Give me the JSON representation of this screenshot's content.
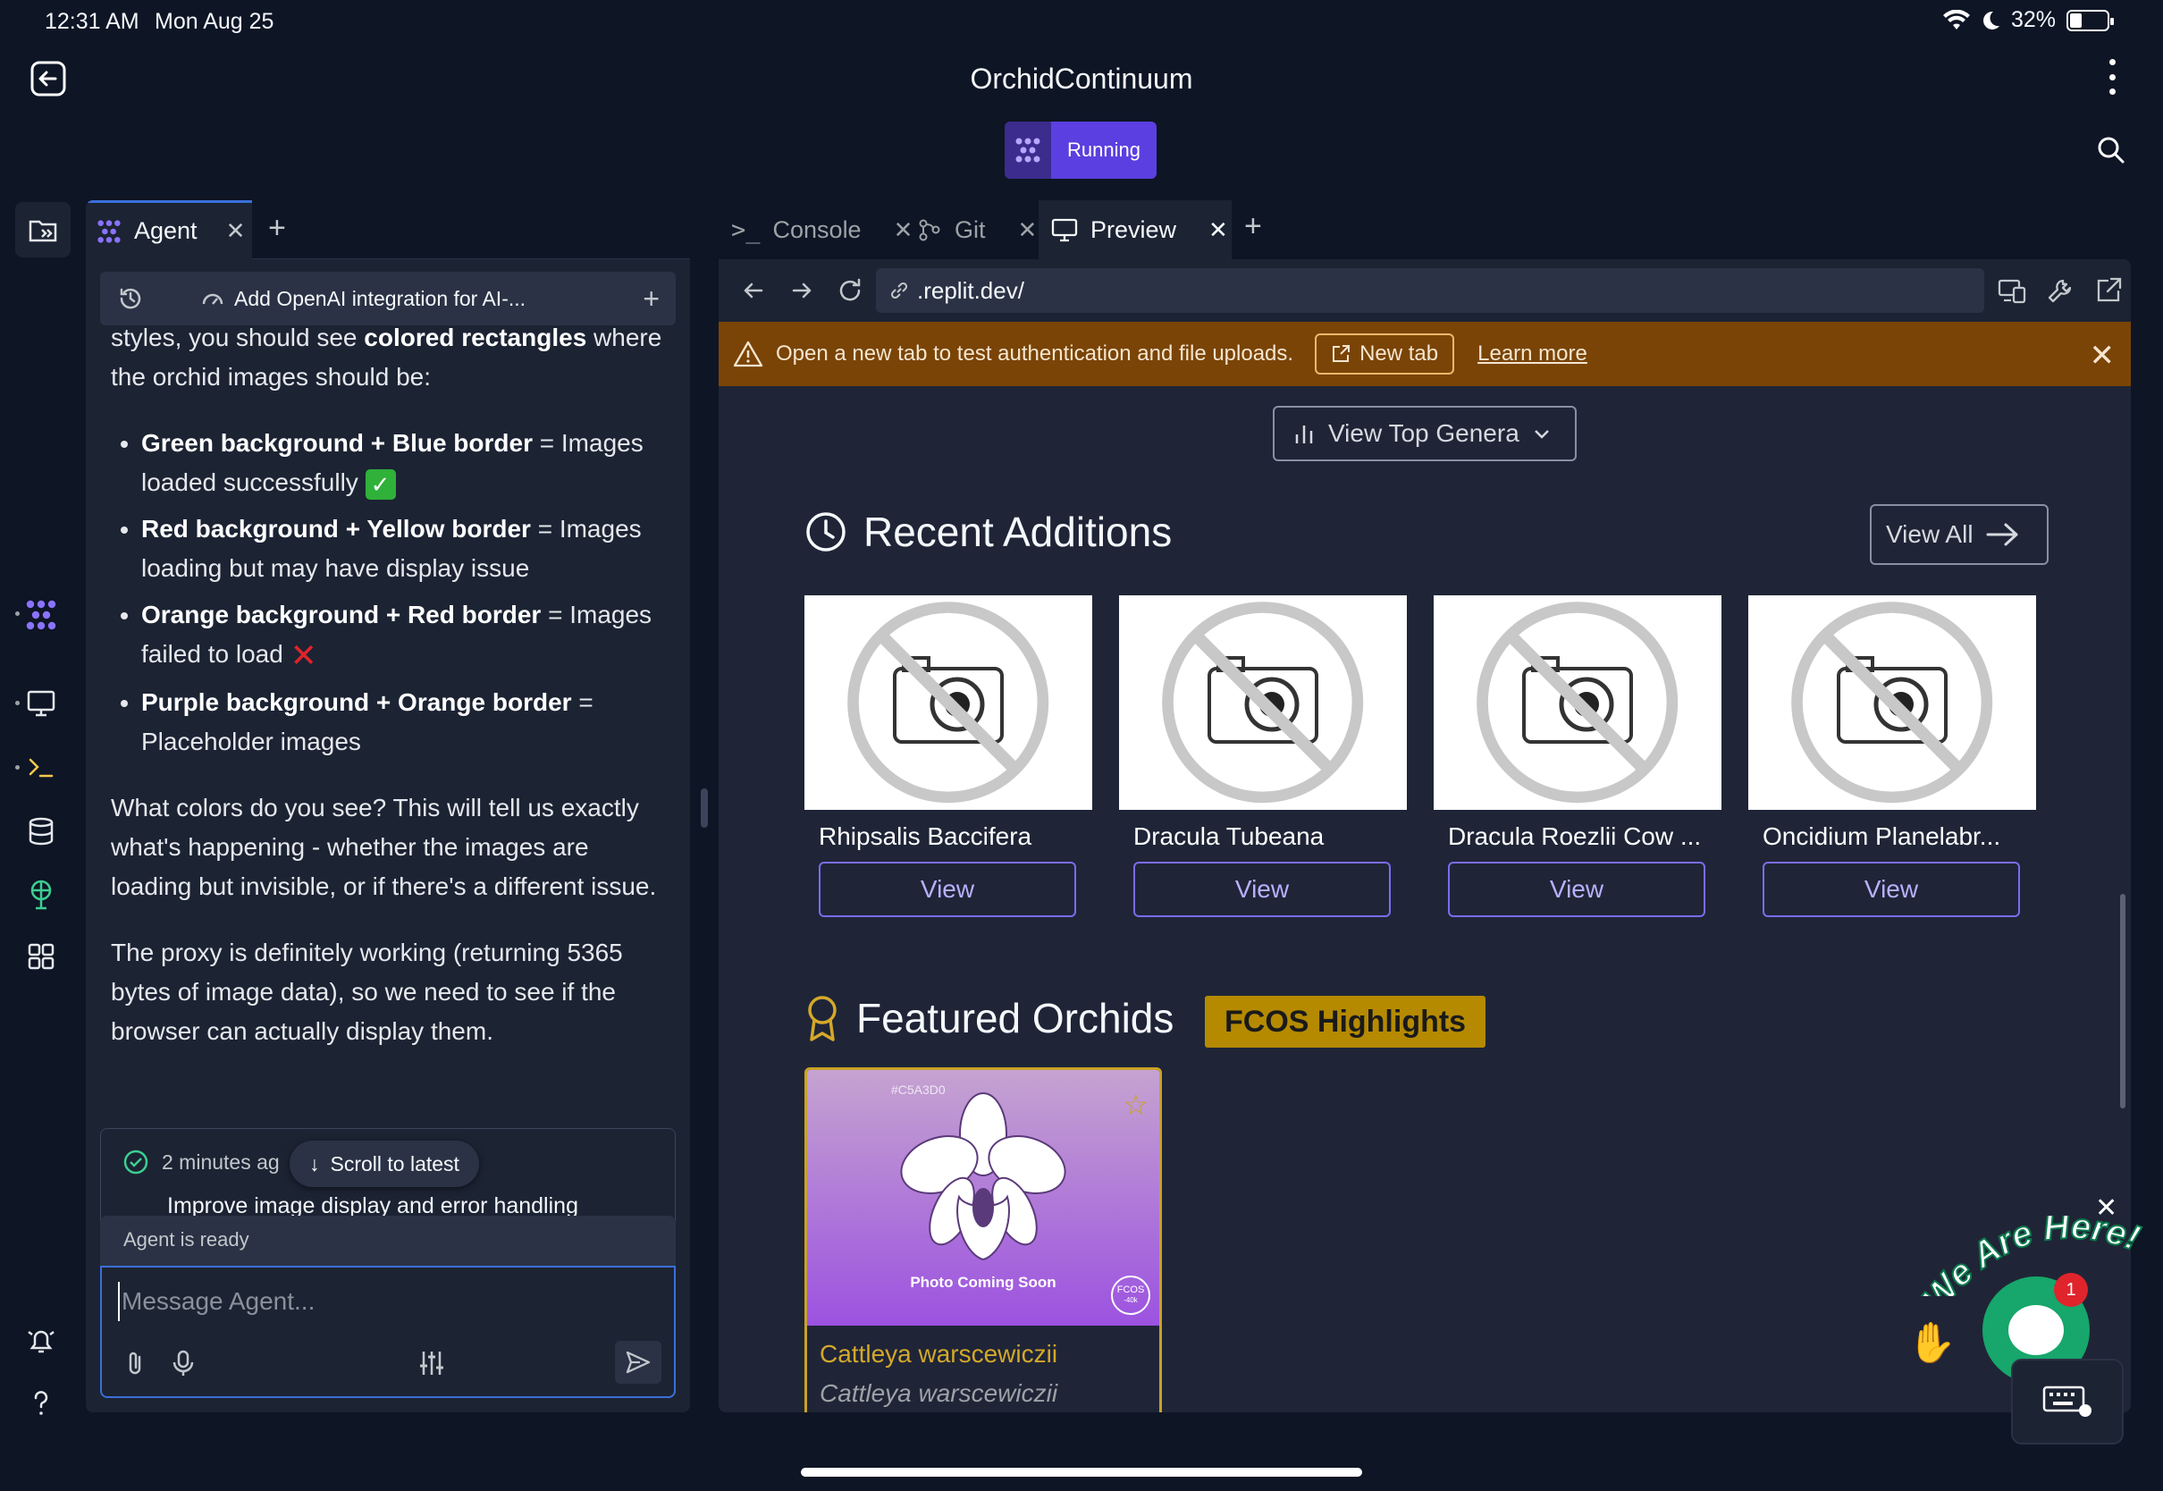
{
  "status_bar": {
    "time": "12:31 AM",
    "date": "Mon Aug 25",
    "battery": "32%"
  },
  "header": {
    "title": "OrchidContinuum",
    "run_status": "Running"
  },
  "agent": {
    "tab_label": "Agent",
    "task_title": "Add OpenAI integration for AI-...",
    "messages": {
      "intro_pre": "styles, you should see ",
      "intro_bold": "colored rectangles",
      "intro_post": " where the orchid images should be:",
      "bullets": [
        {
          "bold": "Green background + Blue border",
          "text": " = Images loaded successfully "
        },
        {
          "bold": "Red background + Yellow border",
          "text": " = Images loading but may have display issue"
        },
        {
          "bold": "Orange background + Red border",
          "text": " = Images failed to load "
        },
        {
          "bold": "Purple background + Orange border",
          "text": " = Placeholder images"
        }
      ],
      "check_emoji": "✓",
      "cross_emoji": "✕",
      "para1": "What colors do you see? This will tell us exactly what's happening - whether the images are loading but invisible, or if there's a different issue.",
      "para2": "The proxy is definitely working (returning 5365 bytes of image data), so we need to see if the browser can actually display them."
    },
    "checkpoint": {
      "time": "2 minutes ag",
      "description": "Improve image display and error handling"
    },
    "scroll_latest": "Scroll to latest",
    "status": "Agent is ready",
    "composer_placeholder": "Message Agent..."
  },
  "workspace": {
    "tabs": [
      {
        "label": "Console"
      },
      {
        "label": "Git"
      },
      {
        "label": "Preview"
      }
    ],
    "url": ".replit.dev/",
    "notice": {
      "message": "Open a new tab to test authentication and file uploads.",
      "new_tab": "New tab",
      "learn_more": "Learn more"
    }
  },
  "preview": {
    "genera_button": "View Top Genera",
    "recent_title": "Recent Additions",
    "view_all": "View All",
    "recent_items": [
      {
        "name": "Rhipsalis Baccifera",
        "action": "View"
      },
      {
        "name": "Dracula Tubeana",
        "action": "View"
      },
      {
        "name": "Dracula Roezlii Cow ...",
        "action": "View"
      },
      {
        "name": "Oncidium Planelabr...",
        "action": "View"
      }
    ],
    "featured_title": "Featured Orchids",
    "featured_badge": "FCOS Highlights",
    "featured": {
      "hex": "#C5A3D0",
      "photo_text": "Photo Coming Soon",
      "seal_top": "FCOS",
      "seal_bottom": "-40k",
      "name": "Cattleya warscewiczii",
      "scientific": "Cattleya warscewiczii"
    }
  },
  "chat_widget": {
    "slogan": "We Are Here!",
    "unread": "1"
  },
  "colors": {
    "accent": "#5b3fe0",
    "notice_bg": "#7a4407",
    "featured_gold": "#c9a227",
    "view_border": "#7b6cf0"
  }
}
